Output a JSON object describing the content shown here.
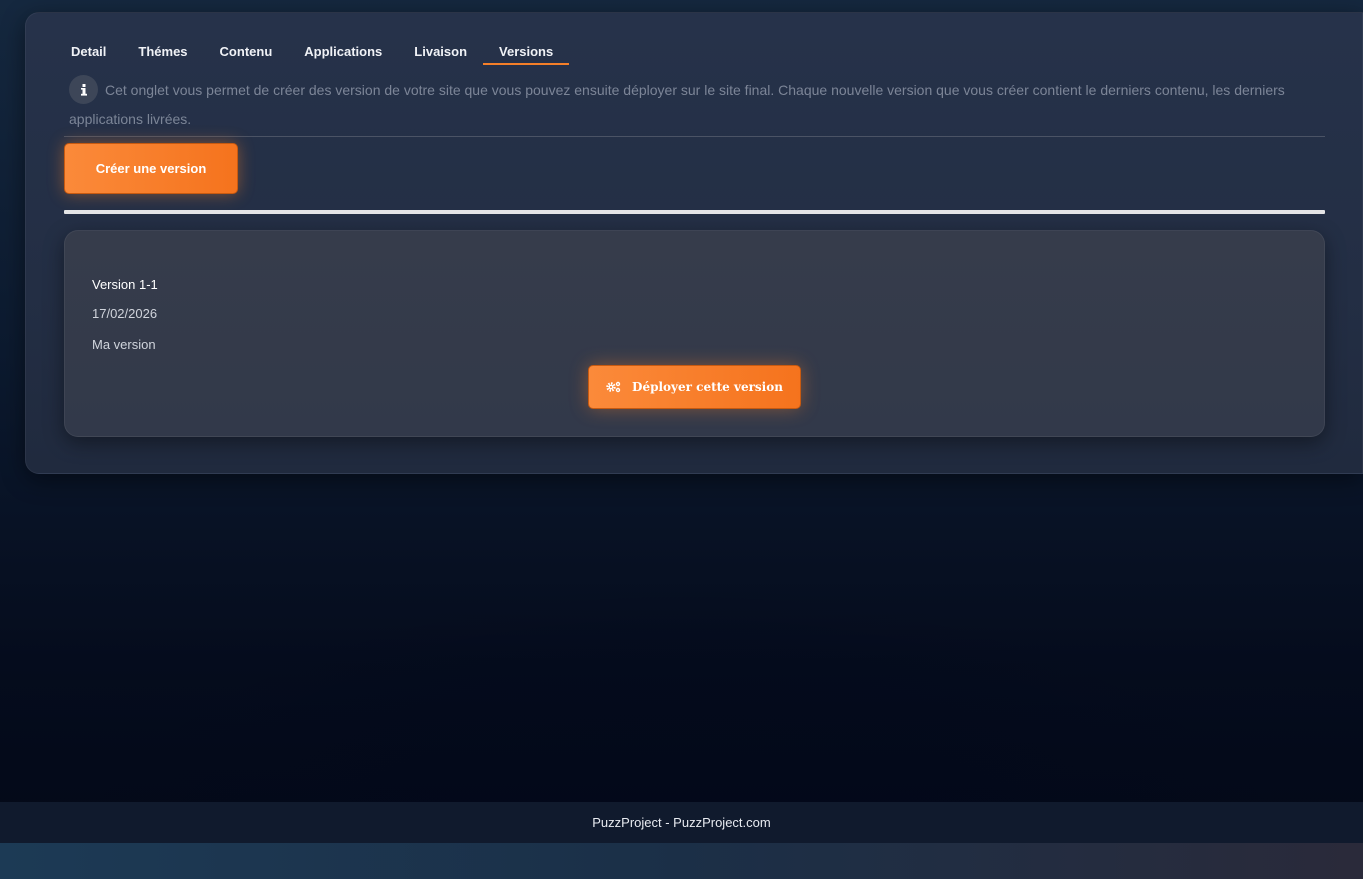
{
  "tabs": [
    {
      "label": "Detail"
    },
    {
      "label": "Thémes"
    },
    {
      "label": "Contenu"
    },
    {
      "label": "Applications"
    },
    {
      "label": "Livaison"
    },
    {
      "label": "Versions",
      "active": true
    }
  ],
  "info": {
    "icon": "info-icon",
    "text": "Cet onglet vous permet de créer des version de votre site que vous pouvez ensuite déployer sur le site final. Chaque nouvelle version que vous créer contient le derniers contenu, les derniers applications livrées."
  },
  "actions": {
    "create_version_label": "Créer une version"
  },
  "version_card": {
    "name": "Version 1-1",
    "date": "17/02/2026",
    "description": "Ma version",
    "deploy_icon": "cogs-icon",
    "deploy_label": "Déployer cette version"
  },
  "footer": {
    "text": "PuzzProject - PuzzProject.com"
  },
  "colors": {
    "accent": "#f57f29",
    "panel": "#232e44",
    "card": "#343b4b",
    "footer": "#101a2d"
  }
}
